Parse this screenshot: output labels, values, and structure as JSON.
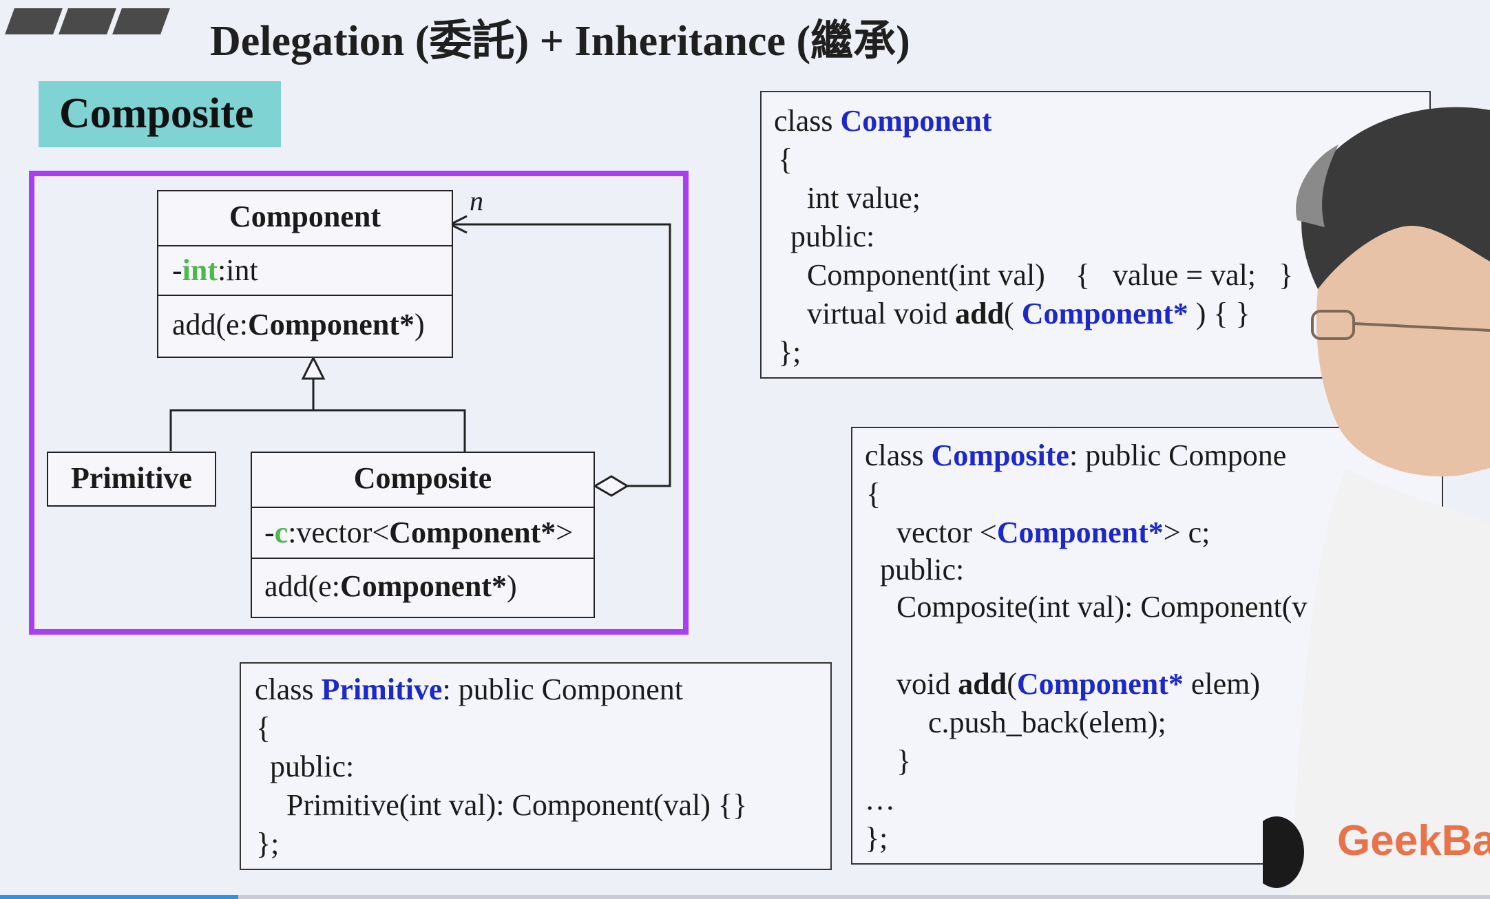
{
  "slide": {
    "title": "Delegation (委託) + Inheritance (繼承)",
    "badge": "Composite"
  },
  "uml": {
    "multiplicity": "n",
    "component": {
      "name": "Component",
      "attr_prefix": "-",
      "attr_name": "int",
      "attr_type": ":int",
      "op_prefix": "add(e:",
      "op_type": "Component*",
      "op_suffix": ")"
    },
    "primitive": {
      "name": "Primitive"
    },
    "composite": {
      "name": "Composite",
      "attr_prefix": "-",
      "attr_name": "c",
      "attr_mid": ":vector<",
      "attr_type": "Component*",
      "attr_suffix": ">",
      "op_prefix": "add(e:",
      "op_type": "Component*",
      "op_suffix": ")"
    }
  },
  "code_component": {
    "l1_kw": "class ",
    "l1_name": "Component",
    "l2": "{",
    "l3": "int value;",
    "l4": "public:",
    "l5": "Component(int val)    {   value = val;   }",
    "l6_a": "virtual void ",
    "l6_b": "add",
    "l6_c": "( ",
    "l6_d": "Component*",
    "l6_e": " ) { }",
    "l7": "};"
  },
  "code_composite": {
    "l1_kw": "class ",
    "l1_name": "Composite",
    "l1_rest": ": public Compone",
    "l2": "{",
    "l3_a": "vector <",
    "l3_b": "Component*",
    "l3_c": "> c;",
    "l4": "public:",
    "l5": "Composite(int val): Component(v",
    "l6_a": "void ",
    "l6_b": "add",
    "l6_c": "(",
    "l6_d": "Component*",
    "l6_e": " elem)",
    "l7": "c.push_back(elem);",
    "l8": "}",
    "l9": "…",
    "l10": "};"
  },
  "code_primitive": {
    "l1_kw": "class ",
    "l1_name": "Primitive",
    "l1_rest": ": public Component",
    "l2": "{",
    "l3": "public:",
    "l4": "Primitive(int val): Component(val) {}",
    "l5": "};"
  },
  "watermark": "GeekBa",
  "video": {
    "progress": 0.16
  },
  "colors": {
    "accent_frame": "#a83ff0",
    "badge": "#7fd3d3",
    "keyword_blue": "#1c28c8",
    "attr_green": "#4db84d",
    "logo": "#e8724a"
  }
}
